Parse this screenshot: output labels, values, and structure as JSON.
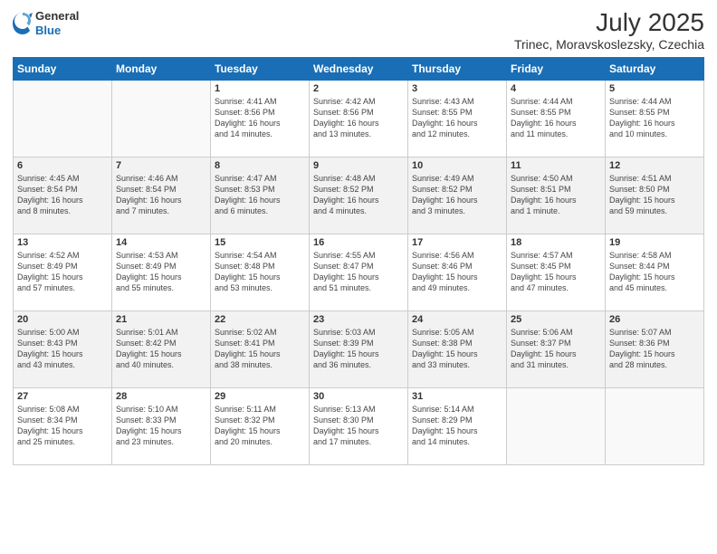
{
  "header": {
    "logo_general": "General",
    "logo_blue": "Blue",
    "title": "July 2025",
    "subtitle": "Trinec, Moravskoslezsky, Czechia"
  },
  "days_of_week": [
    "Sunday",
    "Monday",
    "Tuesday",
    "Wednesday",
    "Thursday",
    "Friday",
    "Saturday"
  ],
  "weeks": [
    [
      {
        "day": "",
        "info": ""
      },
      {
        "day": "",
        "info": ""
      },
      {
        "day": "1",
        "info": "Sunrise: 4:41 AM\nSunset: 8:56 PM\nDaylight: 16 hours\nand 14 minutes."
      },
      {
        "day": "2",
        "info": "Sunrise: 4:42 AM\nSunset: 8:56 PM\nDaylight: 16 hours\nand 13 minutes."
      },
      {
        "day": "3",
        "info": "Sunrise: 4:43 AM\nSunset: 8:55 PM\nDaylight: 16 hours\nand 12 minutes."
      },
      {
        "day": "4",
        "info": "Sunrise: 4:44 AM\nSunset: 8:55 PM\nDaylight: 16 hours\nand 11 minutes."
      },
      {
        "day": "5",
        "info": "Sunrise: 4:44 AM\nSunset: 8:55 PM\nDaylight: 16 hours\nand 10 minutes."
      }
    ],
    [
      {
        "day": "6",
        "info": "Sunrise: 4:45 AM\nSunset: 8:54 PM\nDaylight: 16 hours\nand 8 minutes."
      },
      {
        "day": "7",
        "info": "Sunrise: 4:46 AM\nSunset: 8:54 PM\nDaylight: 16 hours\nand 7 minutes."
      },
      {
        "day": "8",
        "info": "Sunrise: 4:47 AM\nSunset: 8:53 PM\nDaylight: 16 hours\nand 6 minutes."
      },
      {
        "day": "9",
        "info": "Sunrise: 4:48 AM\nSunset: 8:52 PM\nDaylight: 16 hours\nand 4 minutes."
      },
      {
        "day": "10",
        "info": "Sunrise: 4:49 AM\nSunset: 8:52 PM\nDaylight: 16 hours\nand 3 minutes."
      },
      {
        "day": "11",
        "info": "Sunrise: 4:50 AM\nSunset: 8:51 PM\nDaylight: 16 hours\nand 1 minute."
      },
      {
        "day": "12",
        "info": "Sunrise: 4:51 AM\nSunset: 8:50 PM\nDaylight: 15 hours\nand 59 minutes."
      }
    ],
    [
      {
        "day": "13",
        "info": "Sunrise: 4:52 AM\nSunset: 8:49 PM\nDaylight: 15 hours\nand 57 minutes."
      },
      {
        "day": "14",
        "info": "Sunrise: 4:53 AM\nSunset: 8:49 PM\nDaylight: 15 hours\nand 55 minutes."
      },
      {
        "day": "15",
        "info": "Sunrise: 4:54 AM\nSunset: 8:48 PM\nDaylight: 15 hours\nand 53 minutes."
      },
      {
        "day": "16",
        "info": "Sunrise: 4:55 AM\nSunset: 8:47 PM\nDaylight: 15 hours\nand 51 minutes."
      },
      {
        "day": "17",
        "info": "Sunrise: 4:56 AM\nSunset: 8:46 PM\nDaylight: 15 hours\nand 49 minutes."
      },
      {
        "day": "18",
        "info": "Sunrise: 4:57 AM\nSunset: 8:45 PM\nDaylight: 15 hours\nand 47 minutes."
      },
      {
        "day": "19",
        "info": "Sunrise: 4:58 AM\nSunset: 8:44 PM\nDaylight: 15 hours\nand 45 minutes."
      }
    ],
    [
      {
        "day": "20",
        "info": "Sunrise: 5:00 AM\nSunset: 8:43 PM\nDaylight: 15 hours\nand 43 minutes."
      },
      {
        "day": "21",
        "info": "Sunrise: 5:01 AM\nSunset: 8:42 PM\nDaylight: 15 hours\nand 40 minutes."
      },
      {
        "day": "22",
        "info": "Sunrise: 5:02 AM\nSunset: 8:41 PM\nDaylight: 15 hours\nand 38 minutes."
      },
      {
        "day": "23",
        "info": "Sunrise: 5:03 AM\nSunset: 8:39 PM\nDaylight: 15 hours\nand 36 minutes."
      },
      {
        "day": "24",
        "info": "Sunrise: 5:05 AM\nSunset: 8:38 PM\nDaylight: 15 hours\nand 33 minutes."
      },
      {
        "day": "25",
        "info": "Sunrise: 5:06 AM\nSunset: 8:37 PM\nDaylight: 15 hours\nand 31 minutes."
      },
      {
        "day": "26",
        "info": "Sunrise: 5:07 AM\nSunset: 8:36 PM\nDaylight: 15 hours\nand 28 minutes."
      }
    ],
    [
      {
        "day": "27",
        "info": "Sunrise: 5:08 AM\nSunset: 8:34 PM\nDaylight: 15 hours\nand 25 minutes."
      },
      {
        "day": "28",
        "info": "Sunrise: 5:10 AM\nSunset: 8:33 PM\nDaylight: 15 hours\nand 23 minutes."
      },
      {
        "day": "29",
        "info": "Sunrise: 5:11 AM\nSunset: 8:32 PM\nDaylight: 15 hours\nand 20 minutes."
      },
      {
        "day": "30",
        "info": "Sunrise: 5:13 AM\nSunset: 8:30 PM\nDaylight: 15 hours\nand 17 minutes."
      },
      {
        "day": "31",
        "info": "Sunrise: 5:14 AM\nSunset: 8:29 PM\nDaylight: 15 hours\nand 14 minutes."
      },
      {
        "day": "",
        "info": ""
      },
      {
        "day": "",
        "info": ""
      }
    ]
  ]
}
